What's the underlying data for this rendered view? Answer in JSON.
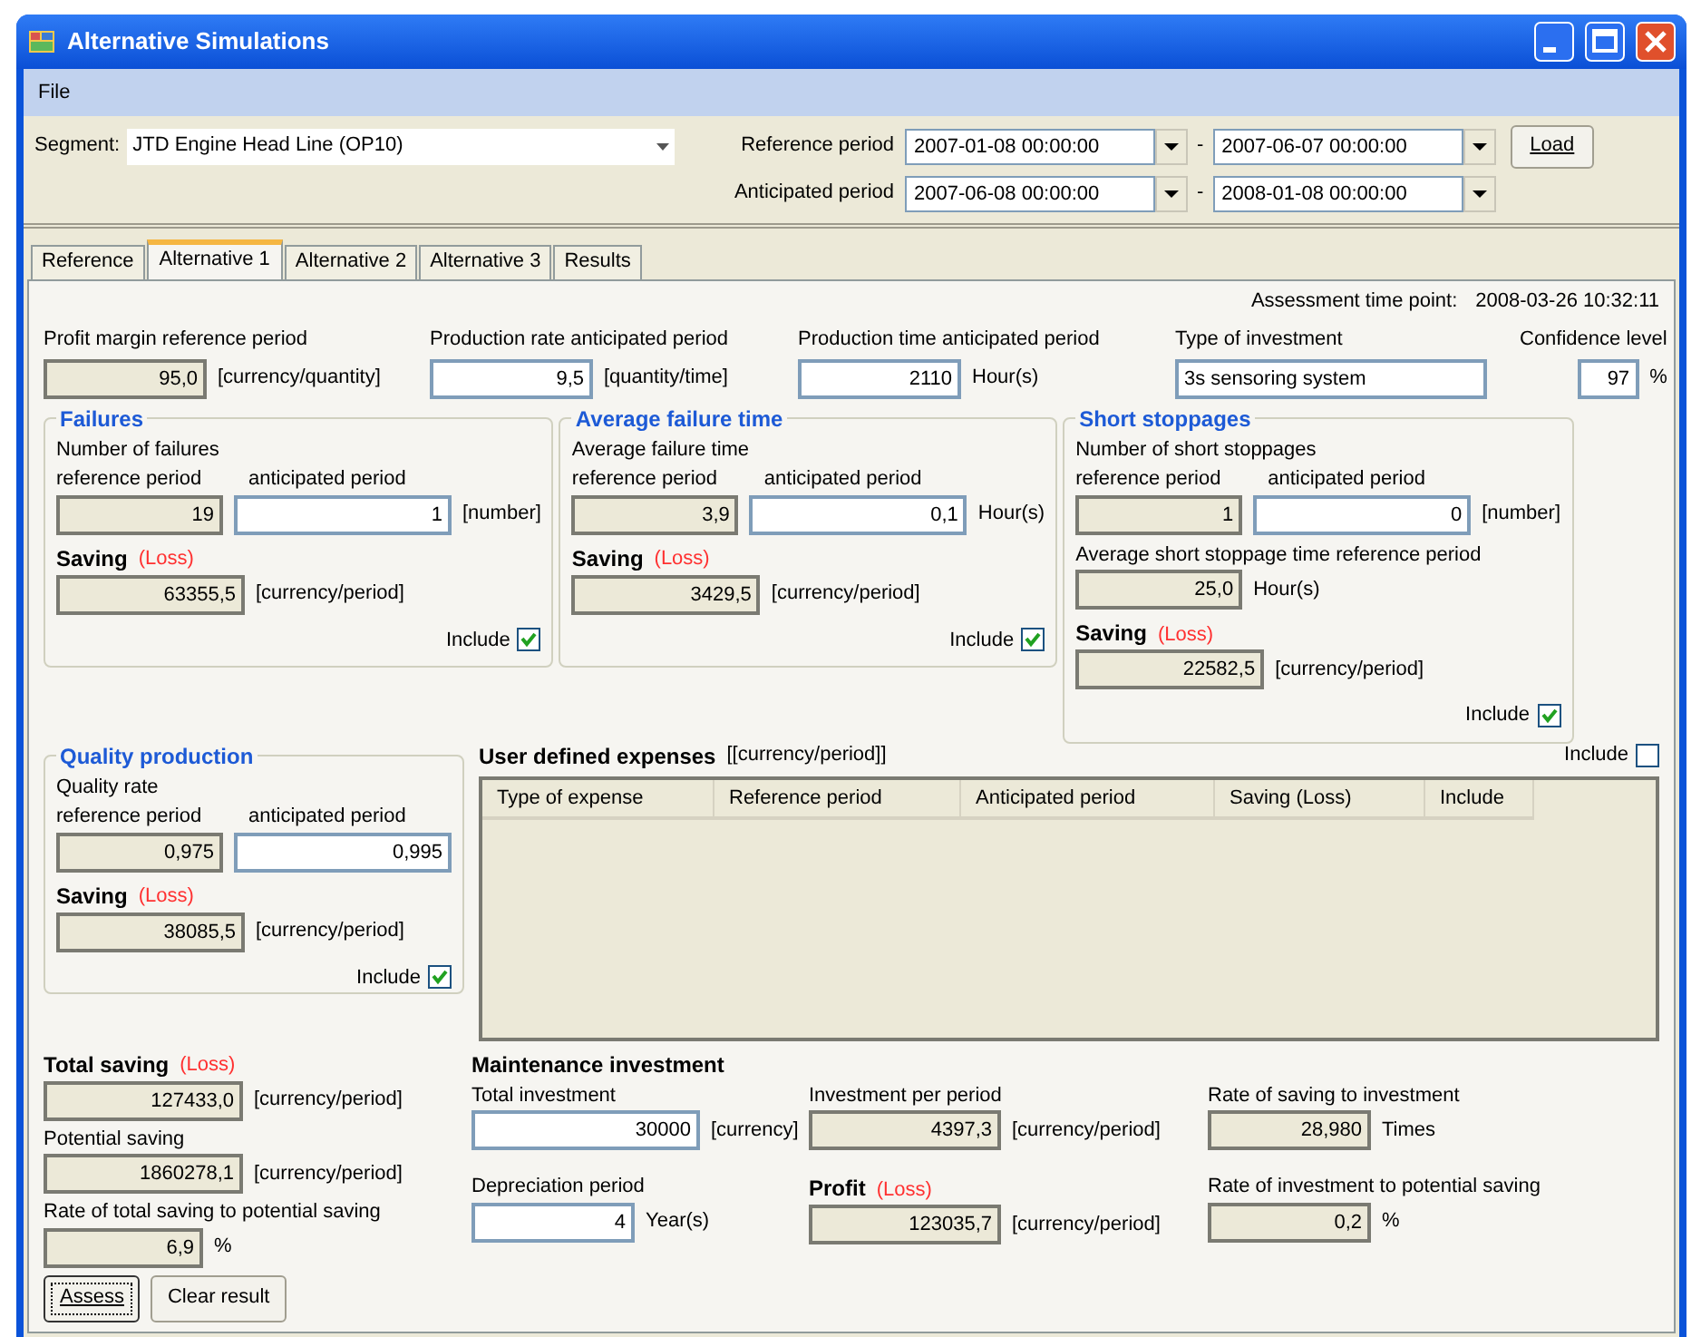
{
  "window": {
    "title": "Alternative Simulations"
  },
  "menu": [
    {
      "label": "File"
    }
  ],
  "segment": {
    "label": "Segment:",
    "value": "JTD Engine Head Line (OP10)"
  },
  "periods": [
    {
      "label": "Reference period",
      "from": "2007-01-08 00:00:00",
      "separator": "-",
      "to": "2007-06-07 00:00:00"
    },
    {
      "label": "Anticipated period",
      "from": "2007-06-08 00:00:00",
      "separator": "-",
      "to": "2008-01-08 00:00:00"
    }
  ],
  "load_button": "Load",
  "tabs": [
    {
      "label": "Reference",
      "selected": false
    },
    {
      "label": "Alternative 1",
      "selected": true
    },
    {
      "label": "Alternative 2",
      "selected": false
    },
    {
      "label": "Alternative 3",
      "selected": false
    },
    {
      "label": "Results",
      "selected": false
    }
  ],
  "assessment": {
    "label": "Assessment time point:",
    "value": "2008-03-26 10:32:11"
  },
  "top_fields": [
    {
      "label": "Profit margin reference period",
      "value": "95,0",
      "unit": "[currency/quantity]",
      "editable": false
    },
    {
      "label": "Production rate anticipated period",
      "value": "9,5",
      "unit": "[quantity/time]",
      "editable": true
    },
    {
      "label": "Production time anticipated period",
      "value": "2110",
      "unit": "Hour(s)",
      "editable": true
    },
    {
      "label": "Type of investment",
      "value": "3s sensoring system",
      "editable": true
    },
    {
      "label": "Confidence level",
      "value": "97",
      "unit": "%",
      "editable": true
    }
  ],
  "groups": [
    {
      "title": "Failures",
      "subtitle": "Number of failures",
      "fields": [
        {
          "label": "reference period",
          "value": "19",
          "editable": false
        },
        {
          "label": "anticipated period",
          "value": "1",
          "unit": "[number]",
          "editable": true
        }
      ],
      "saving": {
        "label": "Saving",
        "loss": "(Loss)",
        "value": "63355,5",
        "unit": "[currency/period]",
        "editable": false
      },
      "include": {
        "label": "Include",
        "checked": true
      }
    },
    {
      "title": "Average failure time",
      "subtitle": "Average failure time",
      "fields": [
        {
          "label": "reference period",
          "value": "3,9",
          "editable": false
        },
        {
          "label": "anticipated period",
          "value": "0,1",
          "unit": "Hour(s)",
          "editable": true
        }
      ],
      "saving": {
        "label": "Saving",
        "loss": "(Loss)",
        "value": "3429,5",
        "unit": "[currency/period]",
        "editable": false
      },
      "include": {
        "label": "Include",
        "checked": true
      }
    },
    {
      "title": "Short stoppages",
      "subtitle": "Number of short stoppages",
      "fields": [
        {
          "label": "reference period",
          "value": "1",
          "editable": false
        },
        {
          "label": "anticipated period",
          "value": "0",
          "unit": "[number]",
          "editable": true
        }
      ],
      "extra": {
        "label": "Average short stoppage time reference period",
        "value": "25,0",
        "unit": "Hour(s)",
        "editable": false
      },
      "saving": {
        "label": "Saving",
        "loss": "(Loss)",
        "value": "22582,5",
        "unit": "[currency/period]",
        "editable": false
      },
      "include": {
        "label": "Include",
        "checked": true
      }
    }
  ],
  "quality": {
    "title": "Quality production",
    "subtitle": "Quality rate",
    "fields": [
      {
        "label": "reference period",
        "value": "0,975",
        "editable": false
      },
      {
        "label": "anticipated period",
        "value": "0,995",
        "editable": true
      }
    ],
    "saving": {
      "label": "Saving",
      "loss": "(Loss)",
      "value": "38085,5",
      "unit": "[currency/period]",
      "editable": false
    },
    "include": {
      "label": "Include",
      "checked": true
    }
  },
  "expenses": {
    "title": "User defined expenses",
    "unit": "[[currency/period]]",
    "include": {
      "label": "Include",
      "checked": false
    },
    "columns": [
      "Type of expense",
      "Reference period",
      "Anticipated period",
      "Saving (Loss)",
      "Include"
    ]
  },
  "totals": {
    "title": "Total saving",
    "loss": "(Loss)",
    "value": "127433,0",
    "unit": "[currency/period]",
    "editable": false,
    "fields": [
      {
        "label": "Potential saving",
        "value": "1860278,1",
        "unit": "[currency/period]",
        "editable": false
      },
      {
        "label": "Rate of total saving to potential saving",
        "value": "6,9",
        "unit": "%",
        "editable": false
      }
    ]
  },
  "maintenance": {
    "title": "Maintenance investment",
    "columns": [
      {
        "fields": [
          {
            "label": "Total investment",
            "value": "30000",
            "unit": "[currency]",
            "editable": true
          },
          {
            "label": "Depreciation period",
            "value": "4",
            "unit": "Year(s)",
            "editable": true
          }
        ]
      },
      {
        "fields": [
          {
            "label": "Investment per period",
            "value": "4397,3",
            "unit": "[currency/period]",
            "editable": false
          },
          {
            "label": "Profit",
            "loss": "(Loss)",
            "value": "123035,7",
            "unit": "[currency/period]",
            "editable": false
          }
        ]
      },
      {
        "fields": [
          {
            "label": "Rate of saving to investment",
            "value": "28,980",
            "unit": "Times",
            "editable": false
          },
          {
            "label": "Rate of investment to potential saving",
            "value": "0,2",
            "unit": "%",
            "editable": false
          }
        ]
      }
    ]
  },
  "buttons": [
    {
      "label": "Assess",
      "focused": true
    },
    {
      "label": "Clear result",
      "focused": false
    }
  ]
}
